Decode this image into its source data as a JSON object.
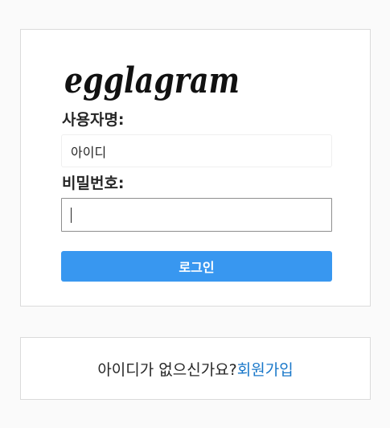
{
  "logo": {
    "text": "egglagram",
    "icon": "egglagram-wordmark"
  },
  "login_form": {
    "username_label": "사용자명:",
    "username_placeholder": "아이디",
    "password_label": "비밀번호:",
    "password_value": "",
    "login_button_label": "로그인"
  },
  "signup": {
    "prompt": "아이디가 없으신가요?",
    "link_label": "회원가입"
  },
  "colors": {
    "background": "#fafafa",
    "card": "#ffffff",
    "border": "#dbdbdb",
    "button": "#3897f0",
    "link": "#1877c9"
  }
}
